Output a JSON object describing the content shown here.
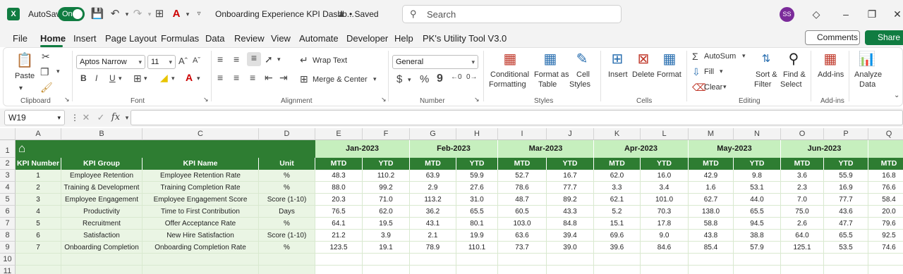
{
  "titlebar": {
    "app_logo": "X",
    "autosave_label": "AutoSave",
    "autosave_state": "On",
    "doc_title": "Onboarding Experience KPI Dashb...",
    "saved_status": "• Saved",
    "search_placeholder": "Search",
    "avatar_initials": "SS"
  },
  "tabs": [
    "File",
    "Home",
    "Insert",
    "Page Layout",
    "Formulas",
    "Data",
    "Review",
    "View",
    "Automate",
    "Developer",
    "Help",
    "PK's Utility Tool V3.0"
  ],
  "active_tab": "Home",
  "buttons": {
    "comments": "Comments",
    "share": "Share"
  },
  "ribbon": {
    "clipboard": {
      "paste": "Paste",
      "group": "Clipboard"
    },
    "font": {
      "name": "Aptos Narrow",
      "size": "11",
      "bold": "B",
      "italic": "I",
      "underline": "U",
      "group": "Font"
    },
    "alignment": {
      "wrap_text": "Wrap Text",
      "merge_center": "Merge & Center",
      "group": "Alignment"
    },
    "number": {
      "format": "General",
      "currency": "$",
      "percent": "%",
      "comma": "9",
      "group": "Number"
    },
    "styles": {
      "conditional_1": "Conditional",
      "conditional_2": "Formatting",
      "format_as_1": "Format as",
      "format_as_2": "Table",
      "cell_1": "Cell",
      "cell_2": "Styles",
      "group": "Styles"
    },
    "cells": {
      "insert": "Insert",
      "delete": "Delete",
      "format": "Format",
      "group": "Cells"
    },
    "editing": {
      "autosum": "AutoSum",
      "fill": "Fill",
      "clear": "Clear",
      "sort_1": "Sort &",
      "sort_2": "Filter",
      "find_1": "Find &",
      "find_2": "Select",
      "group": "Editing"
    },
    "addins": {
      "addins": "Add-ins",
      "group": "Add-ins"
    },
    "analyze": {
      "line1": "Analyze",
      "line2": "Data"
    }
  },
  "formula_bar": {
    "name_box": "W19",
    "fx": "fx",
    "content": ""
  },
  "sheet": {
    "columns": [
      "A",
      "B",
      "C",
      "D",
      "E",
      "F",
      "G",
      "H",
      "I",
      "J",
      "K",
      "L",
      "M",
      "N",
      "O",
      "P",
      "Q"
    ],
    "rows": [
      "1",
      "2",
      "3",
      "4",
      "5",
      "6",
      "7",
      "8",
      "9",
      "10",
      "11"
    ],
    "months": [
      "Jan-2023",
      "Feb-2023",
      "Mar-2023",
      "Apr-2023",
      "May-2023",
      "Jun-2023"
    ],
    "headers": [
      "KPI Number",
      "KPI Group",
      "KPI Name",
      "Unit",
      "MTD",
      "YTD",
      "MTD",
      "YTD",
      "MTD",
      "YTD",
      "MTD",
      "YTD",
      "MTD",
      "YTD",
      "MTD",
      "YTD",
      "MTD"
    ],
    "data": [
      [
        "1",
        "Employee Retention",
        "Employee Retention Rate",
        "%",
        "48.3",
        "110.2",
        "63.9",
        "59.9",
        "52.7",
        "16.7",
        "62.0",
        "16.0",
        "42.9",
        "9.8",
        "3.6",
        "55.9",
        "16.8"
      ],
      [
        "2",
        "Training & Development",
        "Training Completion Rate",
        "%",
        "88.0",
        "99.2",
        "2.9",
        "27.6",
        "78.6",
        "77.7",
        "3.3",
        "3.4",
        "1.6",
        "53.1",
        "2.3",
        "16.9",
        "76.6"
      ],
      [
        "3",
        "Employee Engagement",
        "Employee Engagement Score",
        "Score (1-10)",
        "20.3",
        "71.0",
        "113.2",
        "31.0",
        "48.7",
        "89.2",
        "62.1",
        "101.0",
        "62.7",
        "44.0",
        "7.0",
        "77.7",
        "58.4"
      ],
      [
        "4",
        "Productivity",
        "Time to First Contribution",
        "Days",
        "76.5",
        "62.0",
        "36.2",
        "65.5",
        "60.5",
        "43.3",
        "5.2",
        "70.3",
        "138.0",
        "65.5",
        "75.0",
        "43.6",
        "20.0"
      ],
      [
        "5",
        "Recruitment",
        "Offer Acceptance Rate",
        "%",
        "64.1",
        "19.5",
        "43.1",
        "80.1",
        "103.0",
        "84.8",
        "15.1",
        "17.8",
        "58.8",
        "94.5",
        "2.6",
        "47.7",
        "79.6"
      ],
      [
        "6",
        "Satisfaction",
        "New Hire Satisfaction",
        "Score (1-10)",
        "21.2",
        "3.9",
        "2.1",
        "19.9",
        "63.6",
        "39.4",
        "69.6",
        "9.0",
        "43.8",
        "38.8",
        "64.0",
        "65.5",
        "92.5"
      ],
      [
        "7",
        "Onboarding Completion",
        "Onboarding Completion Rate",
        "%",
        "123.5",
        "19.1",
        "78.9",
        "110.1",
        "73.7",
        "39.0",
        "39.6",
        "84.6",
        "85.4",
        "57.9",
        "125.1",
        "53.5",
        "74.6"
      ]
    ]
  },
  "colors": {
    "accent": "#107c41",
    "header_green": "#2e7d32",
    "month_band": "#c6efbe",
    "row_band": "#eaf5e4"
  }
}
